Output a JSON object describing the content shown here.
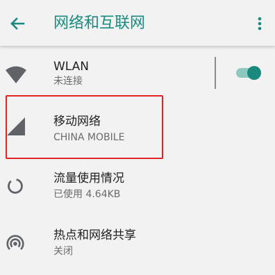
{
  "toolbar": {
    "title": "网络和互联网",
    "back_icon": "arrow-back-icon",
    "more_icon": "more-vert-icon"
  },
  "items": [
    {
      "title": "WLAN",
      "subtitle": "未连接",
      "icon": "wifi-icon",
      "toggle": "on"
    },
    {
      "title": "移动网络",
      "subtitle": "CHINA MOBILE",
      "icon": "cellular-signal-icon",
      "highlighted": true
    },
    {
      "title": "流量使用情况",
      "subtitle": "已使用 4.64KB",
      "icon": "data-usage-icon"
    },
    {
      "title": "热点和网络共享",
      "subtitle": "关闭",
      "icon": "hotspot-icon"
    }
  ],
  "colors": {
    "accent": "#1a8a7e",
    "icon": "#5f6368",
    "background": "#f2f2f2",
    "highlight_border": "#e02424"
  }
}
